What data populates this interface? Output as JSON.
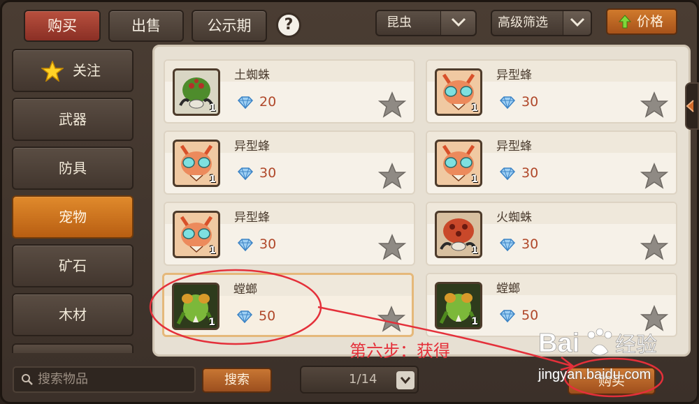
{
  "top_tabs": [
    "购买",
    "出售",
    "公示期"
  ],
  "help_label": "?",
  "category_dropdown": "昆虫",
  "filter_dropdown": "高级筛选",
  "price_sort_label": "价格",
  "sidebar": [
    "关注",
    "武器",
    "防具",
    "宠物",
    "矿石",
    "木材"
  ],
  "sidebar_active": "宠物",
  "items": [
    {
      "name": "土蜘蛛",
      "price": "20",
      "qty": "1",
      "icon": "earth-spider-icon",
      "selected": false
    },
    {
      "name": "异型蜂",
      "price": "30",
      "qty": "1",
      "icon": "alien-bee-icon",
      "selected": false
    },
    {
      "name": "异型蜂",
      "price": "30",
      "qty": "1",
      "icon": "alien-bee-icon",
      "selected": false
    },
    {
      "name": "异型蜂",
      "price": "30",
      "qty": "1",
      "icon": "alien-bee-icon",
      "selected": false
    },
    {
      "name": "异型蜂",
      "price": "30",
      "qty": "1",
      "icon": "alien-bee-icon",
      "selected": false
    },
    {
      "name": "火蜘蛛",
      "price": "30",
      "qty": "1",
      "icon": "fire-spider-icon",
      "selected": false
    },
    {
      "name": "螳螂",
      "price": "50",
      "qty": "1",
      "icon": "mantis-icon",
      "selected": true
    },
    {
      "name": "螳螂",
      "price": "50",
      "qty": "1",
      "icon": "mantis-icon",
      "selected": false
    }
  ],
  "search": {
    "placeholder": "搜索物品",
    "button": "搜索"
  },
  "pager": "1/14",
  "buy_button": "购买",
  "annotation_text": "第六步：获得",
  "watermark": {
    "brand": "Baidu经验",
    "url": "jingyan.baidu.com"
  },
  "colors": {
    "accent": "#d07a2c",
    "active_tab": "#a8402f",
    "price": "#b0482a",
    "annotation": "#e4303a"
  }
}
